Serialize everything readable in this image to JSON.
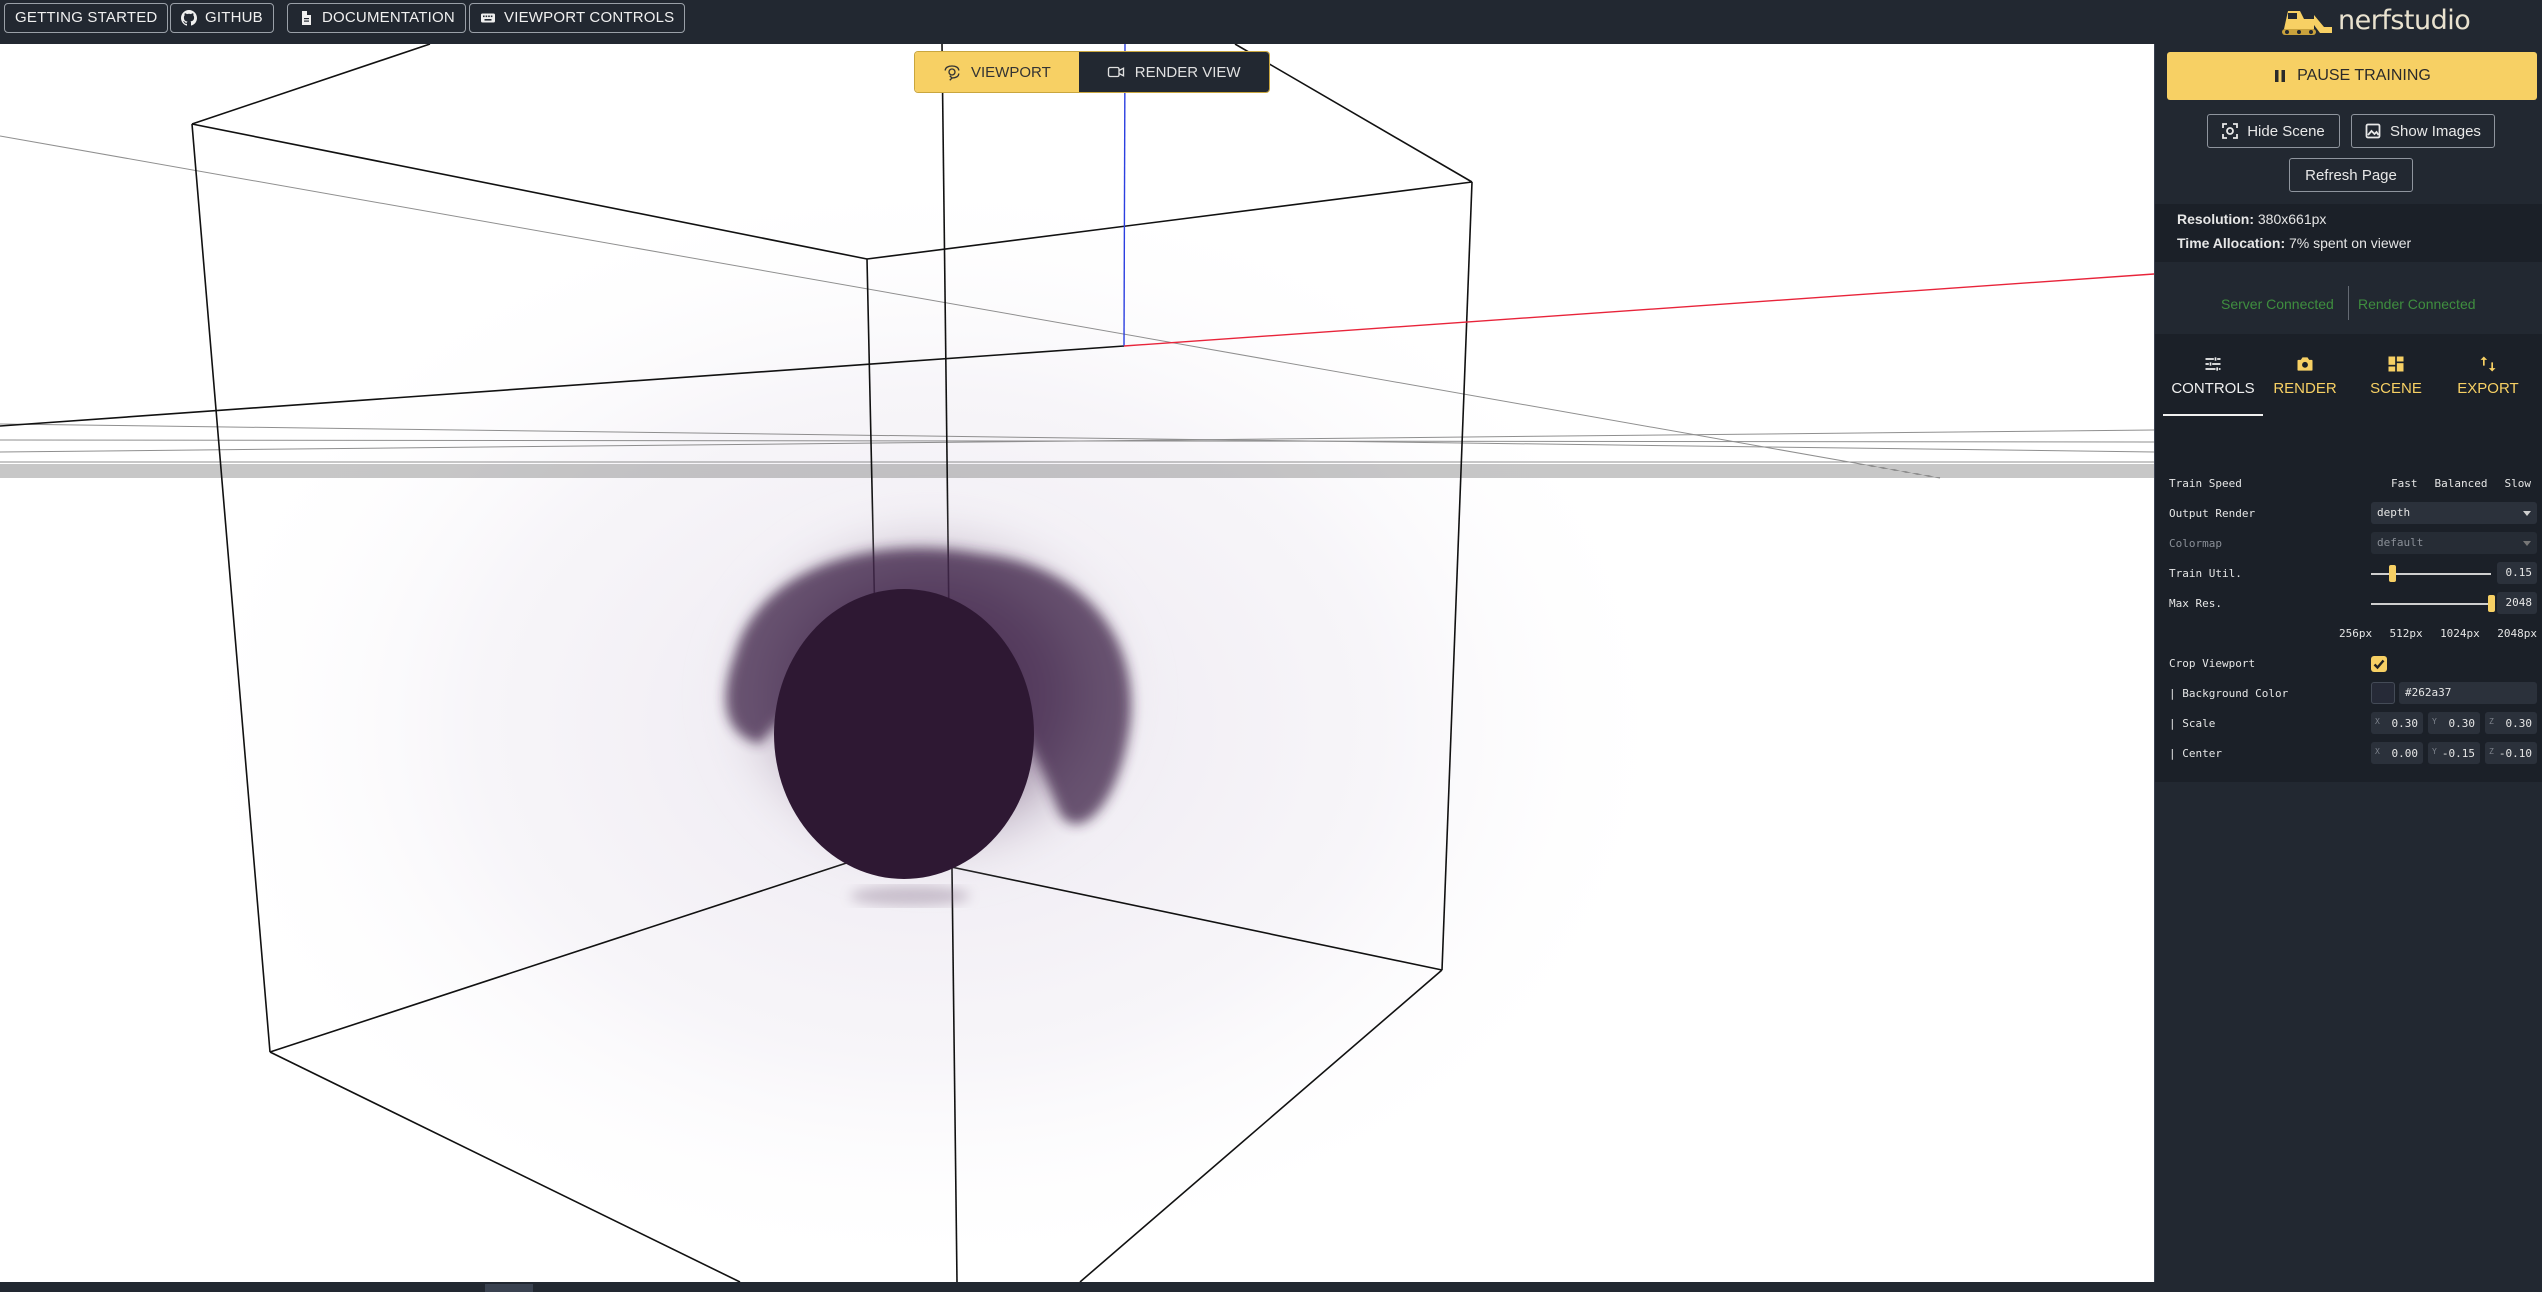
{
  "topbar": {
    "buttons": [
      {
        "label": "GETTING STARTED",
        "icon": ""
      },
      {
        "label": "GITHUB",
        "icon": "github-icon"
      },
      {
        "label": "DOCUMENTATION",
        "icon": "document-icon"
      },
      {
        "label": "VIEWPORT CONTROLS",
        "icon": "keyboard-icon"
      }
    ],
    "logo_text": "nerfstudio"
  },
  "viewport": {
    "toggle": {
      "viewport_label": "VIEWPORT",
      "render_view_label": "RENDER VIEW",
      "active": "viewport"
    }
  },
  "panel": {
    "pause_training_label": "PAUSE TRAINING",
    "hide_scene_label": "Hide Scene",
    "show_images_label": "Show Images",
    "refresh_label": "Refresh Page",
    "stats": {
      "resolution_label": "Resolution:",
      "resolution_value": "380x661px",
      "time_label": "Time Allocation:",
      "time_value": "7% spent on viewer"
    },
    "connection": {
      "server": "Server Connected",
      "render": "Render Connected"
    },
    "tabs": [
      {
        "label": "CONTROLS",
        "icon": "sliders-icon",
        "active": true
      },
      {
        "label": "RENDER",
        "icon": "camera-icon",
        "active": false
      },
      {
        "label": "SCENE",
        "icon": "grid-icon",
        "active": false
      },
      {
        "label": "EXPORT",
        "icon": "import-export-icon",
        "active": false
      }
    ],
    "controls": {
      "train_speed": {
        "label": "Train Speed",
        "options": [
          "Fast",
          "Balanced",
          "Slow"
        ]
      },
      "output_render": {
        "label": "Output Render",
        "value": "depth"
      },
      "colormap": {
        "label": "Colormap",
        "value": "default"
      },
      "train_util": {
        "label": "Train Util.",
        "value": "0.15"
      },
      "max_res": {
        "label": "Max Res.",
        "value": "2048",
        "ticks": [
          "256px",
          "512px",
          "1024px",
          "2048px"
        ]
      },
      "crop_viewport": {
        "label": "Crop Viewport",
        "checked": true
      },
      "background_color": {
        "label": "| Background Color",
        "value": "#262a37"
      },
      "scale": {
        "label": "| Scale",
        "x": "0.30",
        "y": "0.30",
        "z": "0.30"
      },
      "center": {
        "label": "| Center",
        "x": "0.00",
        "y": "-0.15",
        "z": "-0.10"
      }
    }
  },
  "colors": {
    "accent": "#f7d064",
    "panel_bg": "#222831",
    "connected": "#3f8e3f",
    "depth_blob": "#2e1833"
  }
}
